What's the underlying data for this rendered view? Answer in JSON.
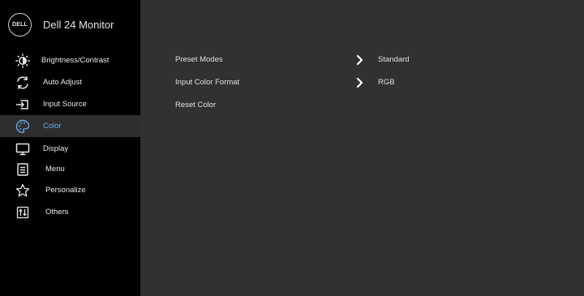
{
  "header": {
    "logo_text": "DELL",
    "title": "Dell 24 Monitor"
  },
  "sidebar": {
    "items": [
      {
        "label": "Brightness/Contrast",
        "icon": "brightness-icon",
        "active": false
      },
      {
        "label": "Auto Adjust",
        "icon": "auto-adjust-icon",
        "active": false
      },
      {
        "label": "Input Source",
        "icon": "input-source-icon",
        "active": false
      },
      {
        "label": "Color",
        "icon": "palette-icon",
        "active": true
      },
      {
        "label": "Display",
        "icon": "display-icon",
        "active": false
      },
      {
        "label": "Menu",
        "icon": "menu-icon",
        "active": false
      },
      {
        "label": "Personalize",
        "icon": "star-icon",
        "active": false
      },
      {
        "label": "Others",
        "icon": "others-icon",
        "active": false
      }
    ]
  },
  "main": {
    "rows": [
      {
        "label": "Preset Modes",
        "value": "Standard",
        "has_arrow": true
      },
      {
        "label": "Input Color Format",
        "value": "RGB",
        "has_arrow": true
      },
      {
        "label": "Reset Color",
        "value": "",
        "has_arrow": false
      }
    ]
  },
  "colors": {
    "sidebar_bg": "#000000",
    "main_bg": "#313131",
    "active_item_bg": "#2e2e2e",
    "active_text": "#6aa6e0",
    "text": "#e8e8e8"
  }
}
